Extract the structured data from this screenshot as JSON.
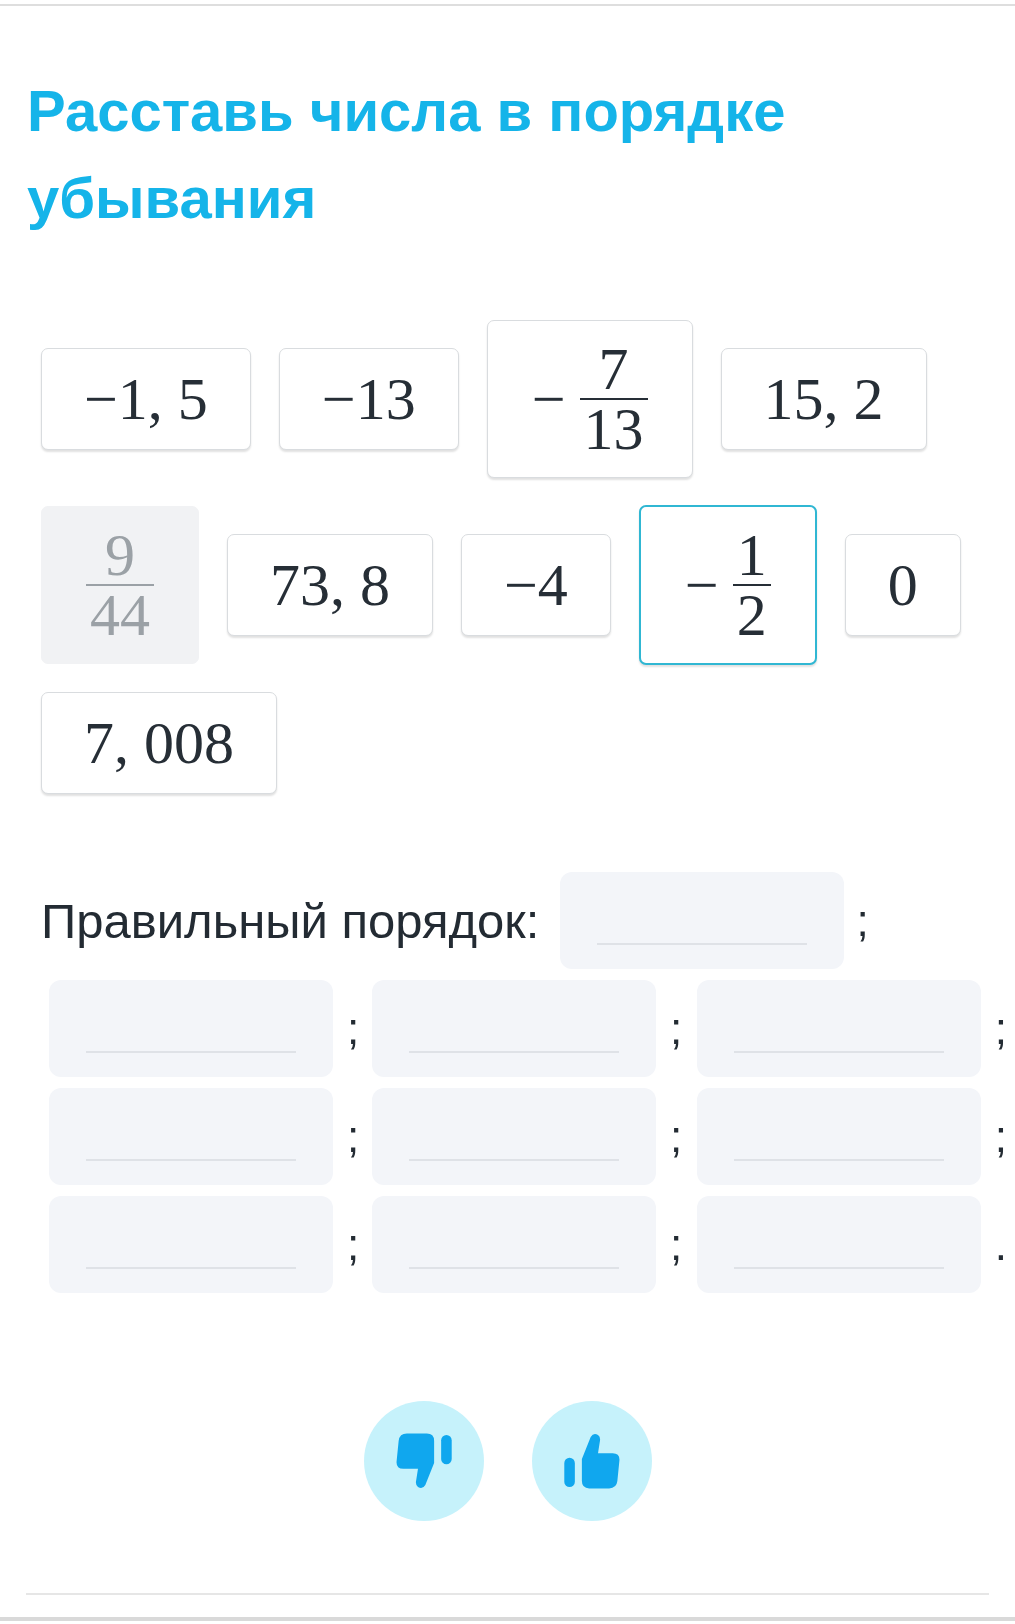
{
  "title": "Расставь числа в порядке убывания",
  "cards": [
    {
      "kind": "number",
      "text": "−1, 5",
      "selected": false,
      "disabled": false
    },
    {
      "kind": "number",
      "text": "−13",
      "selected": false,
      "disabled": false
    },
    {
      "kind": "fraction",
      "sign": "−",
      "numerator": "7",
      "denominator": "13",
      "selected": false,
      "disabled": false
    },
    {
      "kind": "number",
      "text": "15, 2",
      "selected": false,
      "disabled": false
    },
    {
      "kind": "fraction",
      "numerator": "9",
      "denominator": "44",
      "selected": false,
      "disabled": true
    },
    {
      "kind": "number",
      "text": "73, 8",
      "selected": false,
      "disabled": false
    },
    {
      "kind": "number",
      "text": "−4",
      "selected": false,
      "disabled": false
    },
    {
      "kind": "fraction",
      "sign": "−",
      "numerator": "1",
      "denominator": "2",
      "selected": true,
      "disabled": false
    },
    {
      "kind": "number",
      "text": "0",
      "selected": false,
      "disabled": false
    },
    {
      "kind": "number",
      "text": "7, 008",
      "selected": false,
      "disabled": false
    }
  ],
  "answer": {
    "label": "Правильный порядок:",
    "slots": [
      {
        "separator": ";"
      },
      {
        "separator": ";"
      },
      {
        "separator": ";"
      },
      {
        "separator": ";"
      },
      {
        "separator": ";"
      },
      {
        "separator": ";"
      },
      {
        "separator": ";"
      },
      {
        "separator": ";"
      },
      {
        "separator": ";"
      },
      {
        "separator": "."
      }
    ]
  },
  "feedback_buttons": [
    {
      "kind": "dislike"
    },
    {
      "kind": "like"
    }
  ]
}
